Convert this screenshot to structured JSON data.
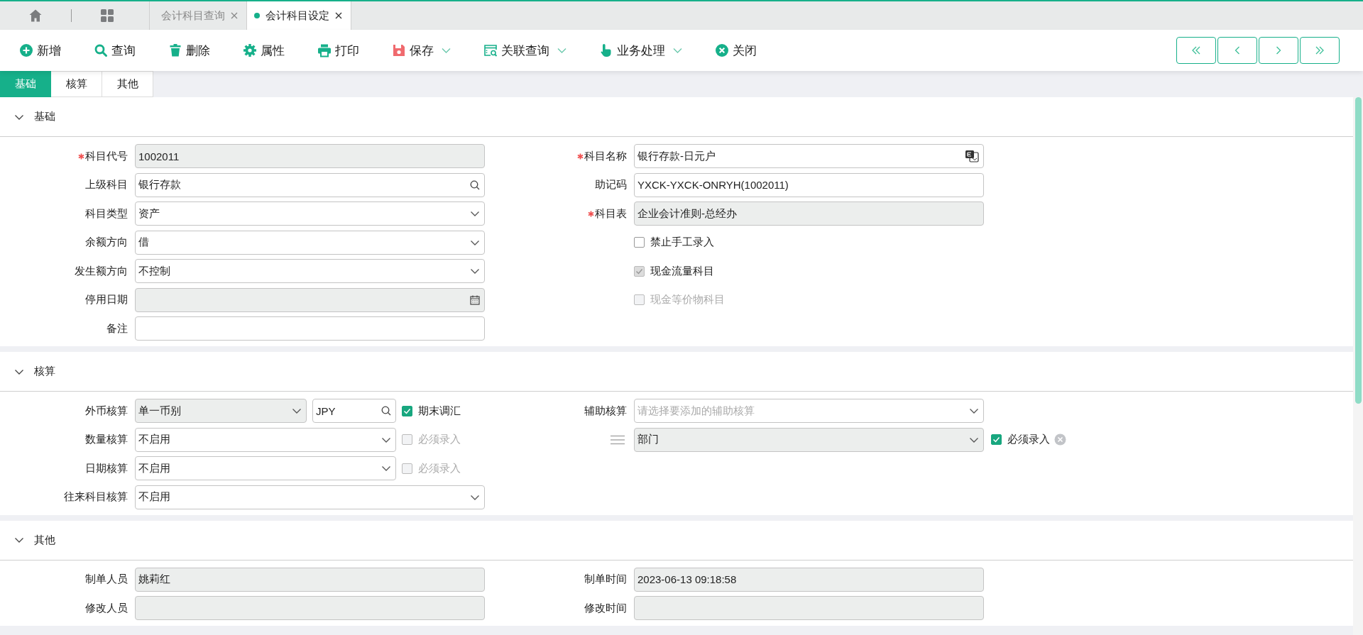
{
  "top_tabs": [
    {
      "label": "会计科目查询",
      "selected": false
    },
    {
      "label": "会计科目设定",
      "selected": true
    }
  ],
  "toolbar": [
    {
      "label": "新增",
      "kind": "add",
      "dropdown": false
    },
    {
      "label": "查询",
      "kind": "search",
      "dropdown": false
    },
    {
      "label": "删除",
      "kind": "delete",
      "dropdown": false
    },
    {
      "label": "属性",
      "kind": "settings",
      "dropdown": false
    },
    {
      "label": "打印",
      "kind": "print",
      "dropdown": false
    },
    {
      "label": "保存",
      "kind": "save",
      "dropdown": true
    },
    {
      "label": "关联查询",
      "kind": "linked-search",
      "dropdown": true
    },
    {
      "label": "业务处理",
      "kind": "hand",
      "dropdown": true
    },
    {
      "label": "关闭",
      "kind": "close",
      "dropdown": false
    }
  ],
  "form_tabs": [
    {
      "label": "基础",
      "selected": true
    },
    {
      "label": "核算",
      "selected": false
    },
    {
      "label": "其他",
      "selected": false
    }
  ],
  "sections": [
    {
      "title": "基础",
      "expanded": true,
      "columns": [
        [
          {
            "label": "科目代号",
            "required": true,
            "controls": [
              {
                "kind": "text",
                "value": "1002011",
                "disabled": true
              }
            ]
          },
          {
            "label": "上级科目",
            "required": false,
            "controls": [
              {
                "kind": "lookup",
                "value": "银行存款",
                "disabled": false
              }
            ]
          },
          {
            "label": "科目类型",
            "required": false,
            "controls": [
              {
                "kind": "select",
                "value": "资产",
                "disabled": false
              }
            ]
          },
          {
            "label": "余额方向",
            "required": false,
            "controls": [
              {
                "kind": "select",
                "value": "借",
                "disabled": false
              }
            ]
          },
          {
            "label": "发生额方向",
            "required": false,
            "controls": [
              {
                "kind": "select",
                "value": "不控制",
                "disabled": false
              }
            ]
          },
          {
            "label": "停用日期",
            "required": false,
            "controls": [
              {
                "kind": "date",
                "disabled": true
              }
            ]
          },
          {
            "label": "备注",
            "required": false,
            "controls": [
              {
                "kind": "text",
                "disabled": false
              }
            ]
          }
        ],
        [
          {
            "label": "科目名称",
            "required": true,
            "controls": [
              {
                "kind": "translate",
                "value": "银行存款-日元户",
                "disabled": false
              }
            ]
          },
          {
            "label": "助记码",
            "required": false,
            "controls": [
              {
                "kind": "text",
                "value": "YXCK-YXCK-ONRYH(1002011)",
                "disabled": false
              }
            ]
          },
          {
            "label": "科目表",
            "required": true,
            "controls": [
              {
                "kind": "text",
                "value": "企业会计准则-总经办",
                "disabled": true
              }
            ]
          },
          {
            "controls": [
              {
                "kind": "checkbox",
                "label": "禁止手工录入",
                "checked": false,
                "disabled": false
              }
            ]
          },
          {
            "controls": [
              {
                "kind": "checkbox",
                "label": "现金流量科目",
                "checked": true,
                "disabled": true
              }
            ]
          },
          {
            "controls": [
              {
                "kind": "checkbox",
                "label": "现金等价物科目",
                "checked": false,
                "disabled": true
              }
            ]
          }
        ]
      ]
    },
    {
      "title": "核算",
      "expanded": true,
      "columns": [
        [
          {
            "label": "外币核算",
            "required": false,
            "controls": [
              {
                "kind": "select",
                "value": "单一币别",
                "disabled": true
              },
              {
                "kind": "lookup",
                "value": "JPY",
                "disabled": false
              },
              {
                "kind": "checkbox",
                "label": "期末调汇",
                "checked": true,
                "disabled": false
              }
            ]
          },
          {
            "label": "数量核算",
            "required": false,
            "controls": [
              {
                "kind": "select",
                "value": "不启用",
                "disabled": false
              },
              {
                "kind": "checkbox",
                "label": "必须录入",
                "checked": false,
                "disabled": true
              }
            ]
          },
          {
            "label": "日期核算",
            "required": false,
            "controls": [
              {
                "kind": "select",
                "value": "不启用",
                "disabled": false
              },
              {
                "kind": "checkbox",
                "label": "必须录入",
                "checked": false,
                "disabled": true
              }
            ]
          },
          {
            "label": "往来科目核算",
            "required": false,
            "controls": [
              {
                "kind": "select",
                "value": "不启用",
                "disabled": false
              }
            ]
          }
        ],
        [
          {
            "label": "辅助核算",
            "required": false,
            "draggable": false,
            "controls": [
              {
                "kind": "select",
                "placeholder": "请选择要添加的辅助核算",
                "disabled": false
              }
            ]
          },
          {
            "draggable": true,
            "controls": [
              {
                "kind": "select",
                "value": "部门",
                "disabled": true
              }
            ],
            "trailing": [
              {
                "kind": "checkbox",
                "label": "必须录入",
                "checked": true,
                "disabled": false
              },
              {
                "kind": "remove"
              }
            ]
          }
        ]
      ]
    },
    {
      "title": "其他",
      "expanded": true,
      "columns": [
        [
          {
            "label": "制单人员",
            "required": false,
            "controls": [
              {
                "kind": "text",
                "value": "姚莉红",
                "disabled": true
              }
            ]
          },
          {
            "label": "修改人员",
            "required": false,
            "controls": [
              {
                "kind": "text",
                "disabled": true
              }
            ]
          }
        ],
        [
          {
            "label": "制单时间",
            "required": false,
            "controls": [
              {
                "kind": "text",
                "value": "2023-06-13 09:18:58",
                "disabled": true
              }
            ]
          },
          {
            "label": "修改时间",
            "required": false,
            "controls": [
              {
                "kind": "text",
                "disabled": true
              }
            ]
          }
        ]
      ]
    }
  ]
}
